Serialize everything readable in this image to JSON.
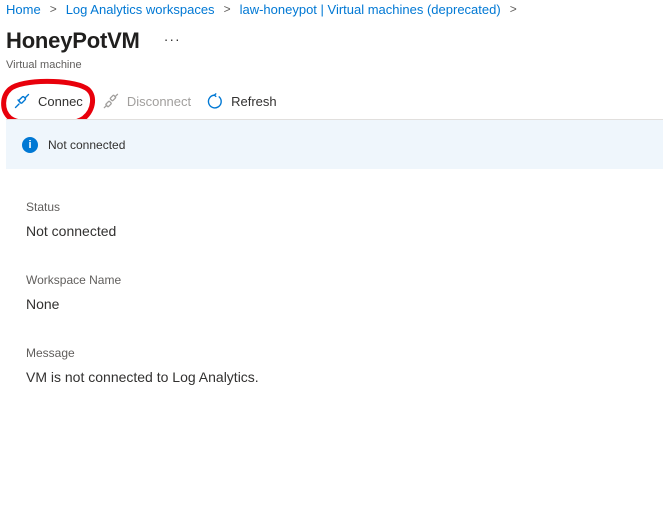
{
  "breadcrumb": {
    "items": [
      "Home",
      "Log Analytics workspaces",
      "law-honeypot | Virtual machines (deprecated)"
    ],
    "separator": ">"
  },
  "header": {
    "title": "HoneyPotVM",
    "more": "···",
    "subtitle": "Virtual machine"
  },
  "toolbar": {
    "connect_label": "Connec",
    "disconnect_label": "Disconnect",
    "refresh_label": "Refresh"
  },
  "info_bar": {
    "icon": "i",
    "text": "Not connected"
  },
  "details": {
    "status_label": "Status",
    "status_value": "Not connected",
    "workspace_label": "Workspace Name",
    "workspace_value": "None",
    "message_label": "Message",
    "message_value": "VM is not connected to Log Analytics."
  },
  "colors": {
    "accent": "#0078d4",
    "annotation": "#e8000b",
    "info_background": "#eff6fc",
    "disabled": "#a19f9d"
  },
  "icons": {
    "connect": "plug-connect-icon",
    "disconnect": "plug-disconnect-icon",
    "refresh": "refresh-icon",
    "info": "info-icon",
    "more": "more-icon",
    "chevron": "chevron-right-icon"
  }
}
